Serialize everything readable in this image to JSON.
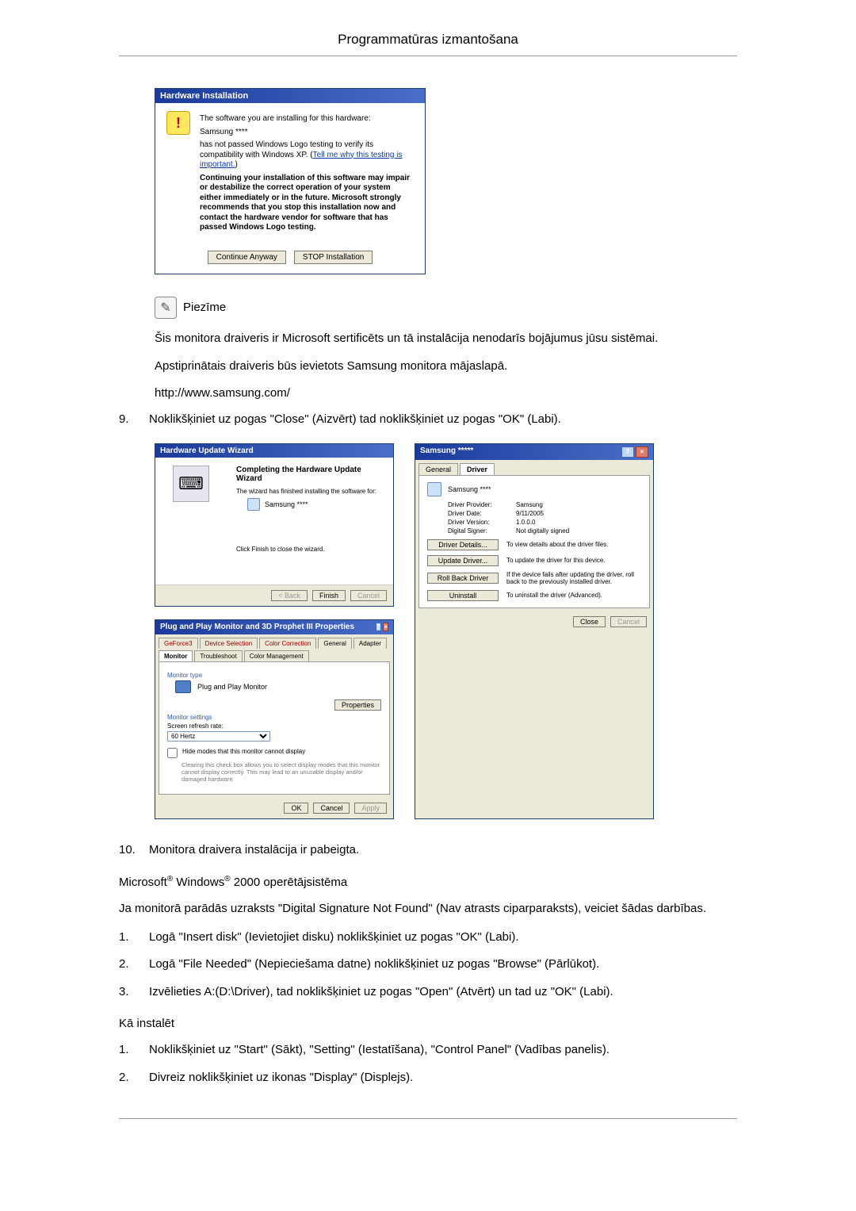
{
  "page": {
    "header": "Programmatūras izmantošana"
  },
  "hwinstall": {
    "title": "Hardware Installation",
    "line1": "The software you are installing for this hardware:",
    "device": "Samsung ****",
    "line2a": "has not passed Windows Logo testing to verify its compatibility with Windows XP. (",
    "tellme": "Tell me why this testing is important.",
    "line2b": ")",
    "warn": "Continuing your installation of this software may impair or destabilize the correct operation of your system either immediately or in the future. Microsoft strongly recommends that you stop this installation now and contact the hardware vendor for software that has passed Windows Logo testing.",
    "btnContinue": "Continue Anyway",
    "btnStop": "STOP Installation"
  },
  "note": {
    "label": "Piezīme",
    "p1": "Šis monitora draiveris ir Microsoft sertificēts un tā instalācija nenodarīs bojājumus jūsu sistēmai.",
    "p2": "Apstiprinātais draiveris būs ievietots Samsung monitora mājaslapā.",
    "url": "http://www.samsung.com/"
  },
  "step9": {
    "num": "9.",
    "text": "Noklikšķiniet uz pogas \"Close\" (Aizvērt) tad noklikšķiniet uz pogas \"OK\" (Labi)."
  },
  "wizard": {
    "title": "Hardware Update Wizard",
    "heading": "Completing the Hardware Update Wizard",
    "line1": "The wizard has finished installing the software for:",
    "device": "Samsung ****",
    "line2": "Click Finish to close the wizard.",
    "btnBack": "< Back",
    "btnFinish": "Finish",
    "btnCancel": "Cancel"
  },
  "props": {
    "title": "Samsung *****",
    "tabs": {
      "general": "General",
      "driver": "Driver"
    },
    "device": "Samsung ****",
    "kv": {
      "providerK": "Driver Provider:",
      "providerV": "Samsung",
      "dateK": "Driver Date:",
      "dateV": "9/11/2005",
      "verK": "Driver Version:",
      "verV": "1.0.0.0",
      "signerK": "Digital Signer:",
      "signerV": "Not digitally signed"
    },
    "actions": {
      "details": "Driver Details...",
      "detailsDesc": "To view details about the driver files.",
      "update": "Update Driver...",
      "updateDesc": "To update the driver for this device.",
      "rollback": "Roll Back Driver",
      "rollbackDesc": "If the device fails after updating the driver, roll back to the previously installed driver.",
      "uninstall": "Uninstall",
      "uninstallDesc": "To uninstall the driver (Advanced)."
    },
    "btnClose": "Close",
    "btnCancel": "Cancel"
  },
  "disp": {
    "title": "Plug and Play Monitor and 3D Prophet III Properties",
    "tabs": {
      "geforce3": "GeForce3",
      "devsel": "Device Selection",
      "colorcorr": "Color Correction",
      "general": "General",
      "adapter": "Adapter",
      "monitor": "Monitor",
      "trouble": "Troubleshoot",
      "colormgmt": "Color Management"
    },
    "monitorTypeLabel": "Monitor type",
    "monitorName": "Plug and Play Monitor",
    "propertiesBtn": "Properties",
    "settingsLabel": "Monitor settings",
    "refreshLabel": "Screen refresh rate:",
    "refreshValue": "60 Hertz",
    "hideLabel": "Hide modes that this monitor cannot display",
    "hideDesc": "Clearing this check box allows you to select display modes that this monitor cannot display correctly. This may lead to an unusable display and/or damaged hardware.",
    "btnOK": "OK",
    "btnCancel": "Cancel",
    "btnApply": "Apply"
  },
  "step10": {
    "num": "10.",
    "text": "Monitora draivera instalācija ir pabeigta."
  },
  "os2000": {
    "heading_pre": "Microsoft",
    "heading_mid": " Windows",
    "heading_post": " 2000 operētājsistēma",
    "reg": "®",
    "intro": "Ja monitorā parādās uzraksts \"Digital Signature Not Found\" (Nav atrasts ciparparaksts), veiciet šādas darbības.",
    "s1n": "1.",
    "s1": "Logā \"Insert disk\" (Ievietojiet disku) noklikšķiniet uz pogas \"OK\" (Labi).",
    "s2n": "2.",
    "s2": "Logā \"File Needed\" (Nepieciešama datne) noklikšķiniet uz pogas \"Browse\" (Pārlūkot).",
    "s3n": "3.",
    "s3": "Izvēlieties A:(D:\\Driver), tad noklikšķiniet uz pogas \"Open\" (Atvērt) un tad uz \"OK\" (Labi).",
    "howto": "Kā instalēt",
    "i1n": "1.",
    "i1": "Noklikšķiniet uz \"Start\" (Sākt), \"Setting\" (Iestatīšana), \"Control Panel\" (Vadības panelis).",
    "i2n": "2.",
    "i2": "Divreiz noklikšķiniet uz ikonas \"Display\" (Displejs)."
  }
}
